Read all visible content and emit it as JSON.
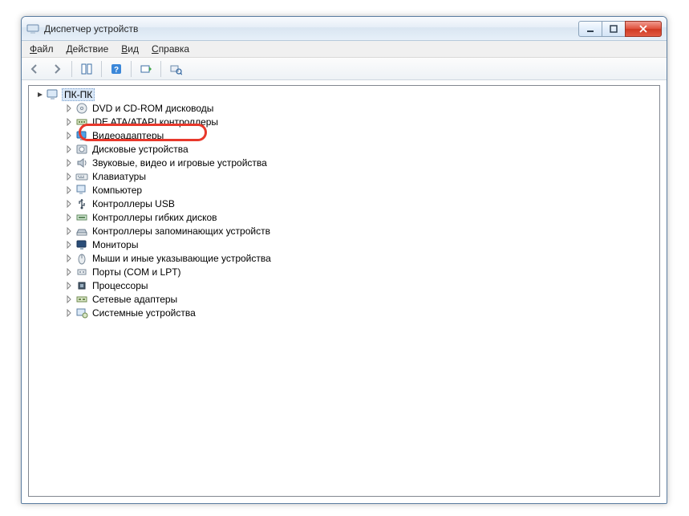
{
  "window": {
    "title": "Диспетчер устройств"
  },
  "menubar": {
    "file": "Файл",
    "action": "Действие",
    "view": "Вид",
    "help": "Справка",
    "file_u": "Ф",
    "action_u": "Д",
    "view_u": "В",
    "help_u": "С"
  },
  "tree": {
    "root": "ПК-ПК",
    "items": [
      {
        "label": "DVD и CD-ROM дисководы",
        "icon": "dvd"
      },
      {
        "label": "IDE ATA/ATAPI контроллеры",
        "icon": "ide"
      },
      {
        "label": "Видеоадаптеры",
        "icon": "display",
        "highlighted": true
      },
      {
        "label": "Дисковые устройства",
        "icon": "disk"
      },
      {
        "label": "Звуковые, видео и игровые устройства",
        "icon": "sound"
      },
      {
        "label": "Клавиатуры",
        "icon": "keyboard"
      },
      {
        "label": "Компьютер",
        "icon": "computer"
      },
      {
        "label": "Контроллеры USB",
        "icon": "usb"
      },
      {
        "label": "Контроллеры гибких дисков",
        "icon": "floppyctl"
      },
      {
        "label": "Контроллеры запоминающих устройств",
        "icon": "storage"
      },
      {
        "label": "Мониторы",
        "icon": "monitor"
      },
      {
        "label": "Мыши и иные указывающие устройства",
        "icon": "mouse"
      },
      {
        "label": "Порты (COM и LPT)",
        "icon": "ports"
      },
      {
        "label": "Процессоры",
        "icon": "cpu"
      },
      {
        "label": "Сетевые адаптеры",
        "icon": "network"
      },
      {
        "label": "Системные устройства",
        "icon": "system"
      }
    ]
  }
}
